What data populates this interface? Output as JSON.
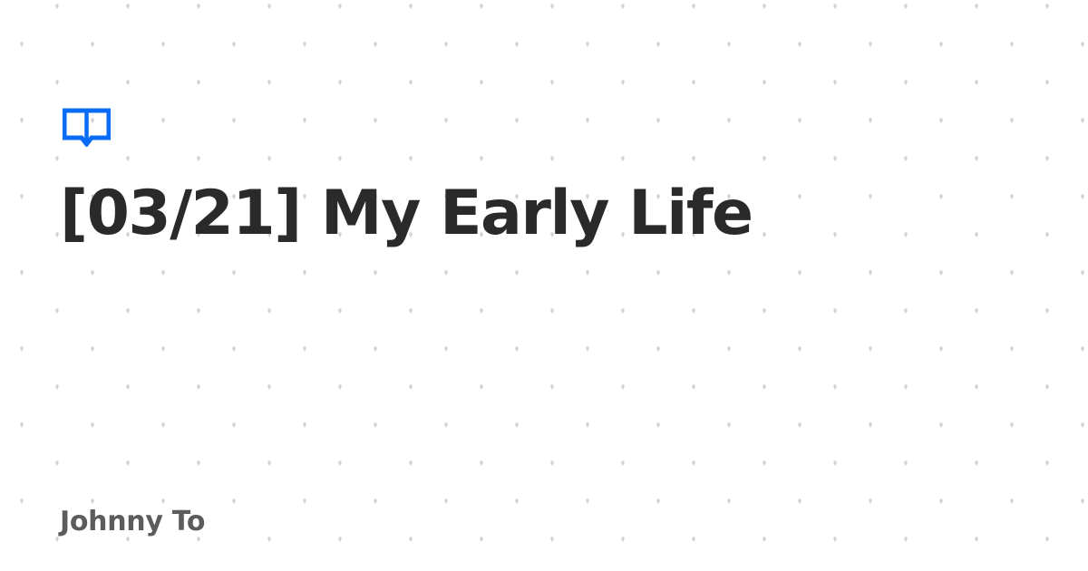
{
  "card": {
    "title": "[03/21] My Early Life",
    "author": "Johnny To"
  },
  "icons": {
    "title_icon": "book-icon"
  },
  "colors": {
    "background": "#ffffff",
    "accent": "#0a6cf5",
    "title_text": "#2a2a2a",
    "author_text": "#5c5c5c",
    "pattern_dot": "#c9c9c9"
  }
}
